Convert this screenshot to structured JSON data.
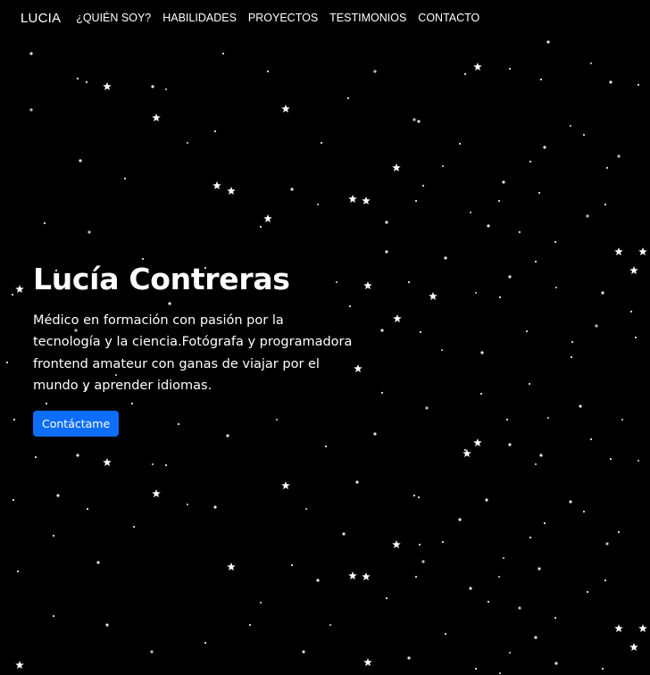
{
  "navbar": {
    "brand": "LUCIA",
    "links": [
      {
        "label": "¿QUIÉN SOY?"
      },
      {
        "label": "HABILIDADES"
      },
      {
        "label": "PROYECTOS"
      },
      {
        "label": "TESTIMONIOS"
      },
      {
        "label": "CONTACTO"
      }
    ]
  },
  "hero": {
    "title": "Lucía Contreras",
    "description": "Médico en formación con pasión por la tecnología y la ciencia.Fotógrafa y programadora frontend amateur con ganas de viajar por el mundo y aprender idiomas.",
    "cta_label": "Contáctame"
  },
  "colors": {
    "background": "#000000",
    "accent": "#0d6efd",
    "text": "#ffffff"
  },
  "icons": {
    "background_pattern": "star-icon"
  }
}
